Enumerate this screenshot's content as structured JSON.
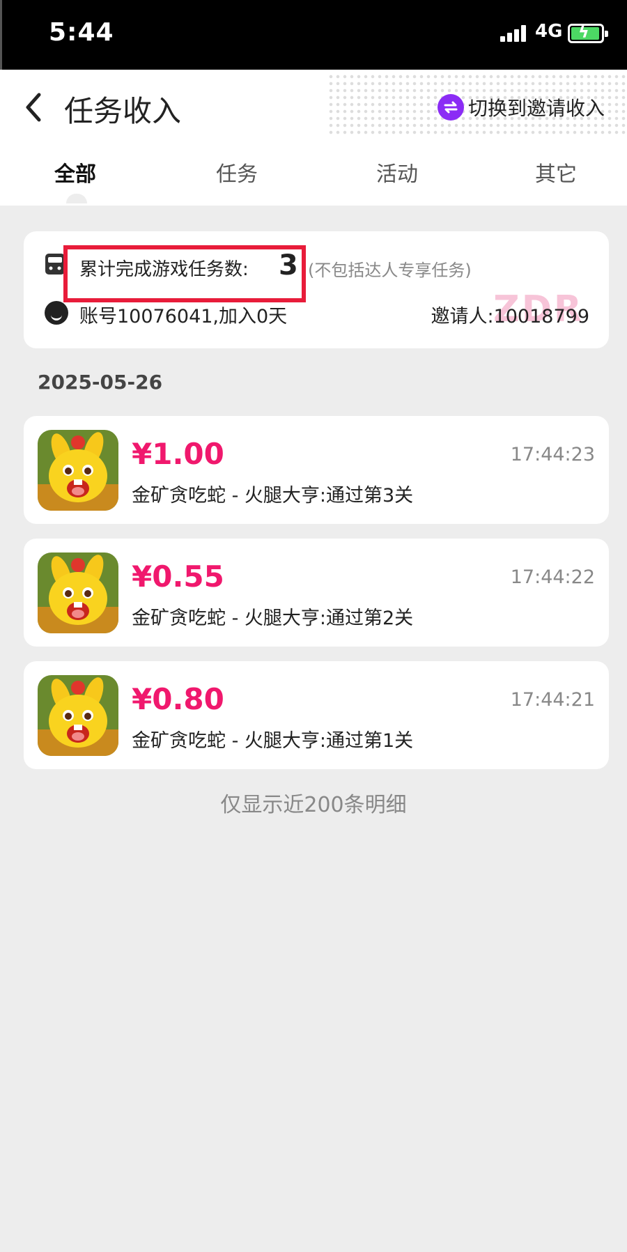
{
  "status_bar": {
    "time": "5:44",
    "network": "4G"
  },
  "header": {
    "title": "任务收入",
    "switch_label": "切换到邀请收入"
  },
  "tabs": [
    {
      "label": "全部",
      "active": true
    },
    {
      "label": "任务",
      "active": false
    },
    {
      "label": "活动",
      "active": false
    },
    {
      "label": "其它",
      "active": false
    }
  ],
  "stats": {
    "label": "累计完成游戏任务数:",
    "value": "3",
    "note": "(不包括达人专享任务)",
    "account": "账号10076041,加入0天",
    "inviter": "邀请人:10018799",
    "watermark": "ZDR"
  },
  "date": "2025-05-26",
  "records": [
    {
      "amount": "¥1.00",
      "time": "17:44:23",
      "desc": "金矿贪吃蛇 - 火腿大亨:通过第3关"
    },
    {
      "amount": "¥0.55",
      "time": "17:44:22",
      "desc": "金矿贪吃蛇 - 火腿大亨:通过第2关"
    },
    {
      "amount": "¥0.80",
      "time": "17:44:21",
      "desc": "金矿贪吃蛇 - 火腿大亨:通过第1关"
    }
  ],
  "footer_note": "仅显示近200条明细",
  "colors": {
    "accent": "#f0186d",
    "switch": "#8b2cf5",
    "highlight": "#e81c3a"
  }
}
